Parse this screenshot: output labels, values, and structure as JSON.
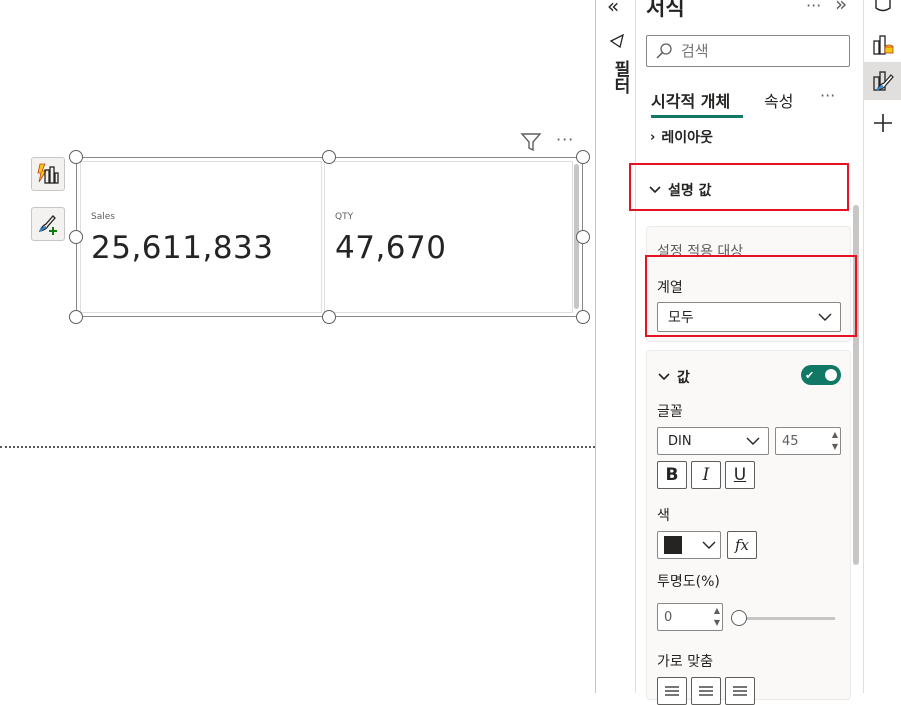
{
  "canvas": {
    "cards": [
      {
        "label": "Sales",
        "value": "25,611,833"
      },
      {
        "label": "QTY",
        "value": "47,670"
      }
    ],
    "more_label": "···"
  },
  "filter": {
    "label": "필터"
  },
  "pane": {
    "title": "서식",
    "more_label": "···",
    "collapse_label": "»",
    "search_placeholder": "검색",
    "tabs": [
      {
        "label": "시각적 개체",
        "active": true
      },
      {
        "label": "속성",
        "active": false
      }
    ],
    "tabs_more": "···",
    "sections": {
      "layout": "레이아웃",
      "callout": "설명 값"
    },
    "apply_settings": {
      "title": "설정 적용 대상",
      "series_label": "계열",
      "series_value": "모두"
    },
    "values": {
      "title": "값",
      "toggle_on": true,
      "font_label": "글꼴",
      "font_family": "DIN",
      "font_size": "45",
      "bold": "B",
      "italic": "I",
      "underline": "U",
      "color_label": "색",
      "color_value": "#252423",
      "fx_label": "fx",
      "transparency_label": "투명도(%)",
      "transparency_value": "0",
      "alignment_label": "가로 맞춤"
    }
  },
  "strip": {
    "collapse_label": "«"
  },
  "colors": {
    "accent": "#117865",
    "highlight": "#e81123",
    "border": "#8a8886"
  }
}
